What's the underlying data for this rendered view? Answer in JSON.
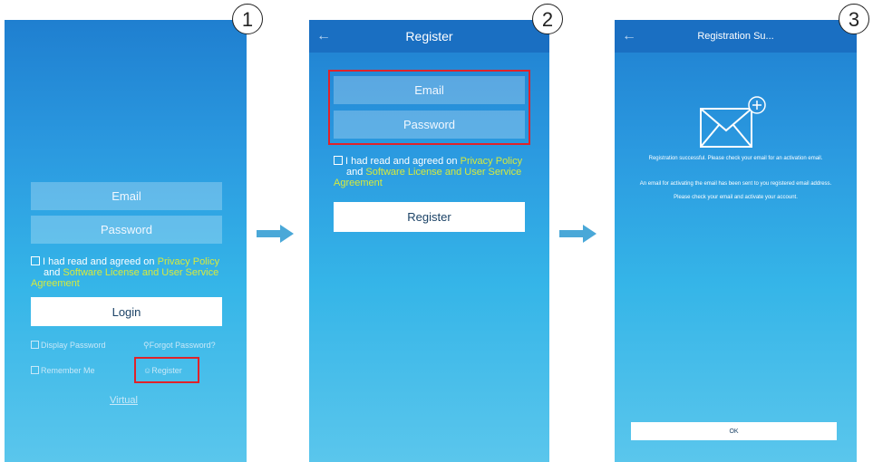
{
  "step_numbers": [
    "1",
    "2",
    "3"
  ],
  "login": {
    "email_placeholder": "Email",
    "password_placeholder": "Password",
    "agree_prefix": "I had read and agreed on",
    "privacy_link": "Privacy Policy",
    "agree_and": "and",
    "license_link": "Software License and User Service Agreement",
    "login_button": "Login",
    "display_password": "Display Password",
    "forgot_password": "Forgot Password?",
    "remember_me": "Remember Me",
    "register": "Register",
    "virtual": "Virtual"
  },
  "register": {
    "title": "Register",
    "back_icon": "arrow-left-icon",
    "email_placeholder": "Email",
    "password_placeholder": "Password",
    "agree_prefix": "I had read and agreed on",
    "privacy_link": "Privacy Policy",
    "agree_and": "and",
    "license_link": "Software License and User Service Agreement",
    "register_button": "Register"
  },
  "success": {
    "title": "Registration Su...",
    "back_icon": "arrow-left-icon",
    "icon": "envelope-plus-icon",
    "message1": "Registration successful. Please check your email for an activation email.",
    "message2": "An email for activating the email has been sent to you registered email address.",
    "message3": "Please check your email and activate your account.",
    "ok_button": "OK"
  },
  "colors": {
    "highlight": "#e0222a",
    "link": "#d7ea3c",
    "topbar": "#1a6fc2",
    "arrow": "#4aa8d8"
  }
}
